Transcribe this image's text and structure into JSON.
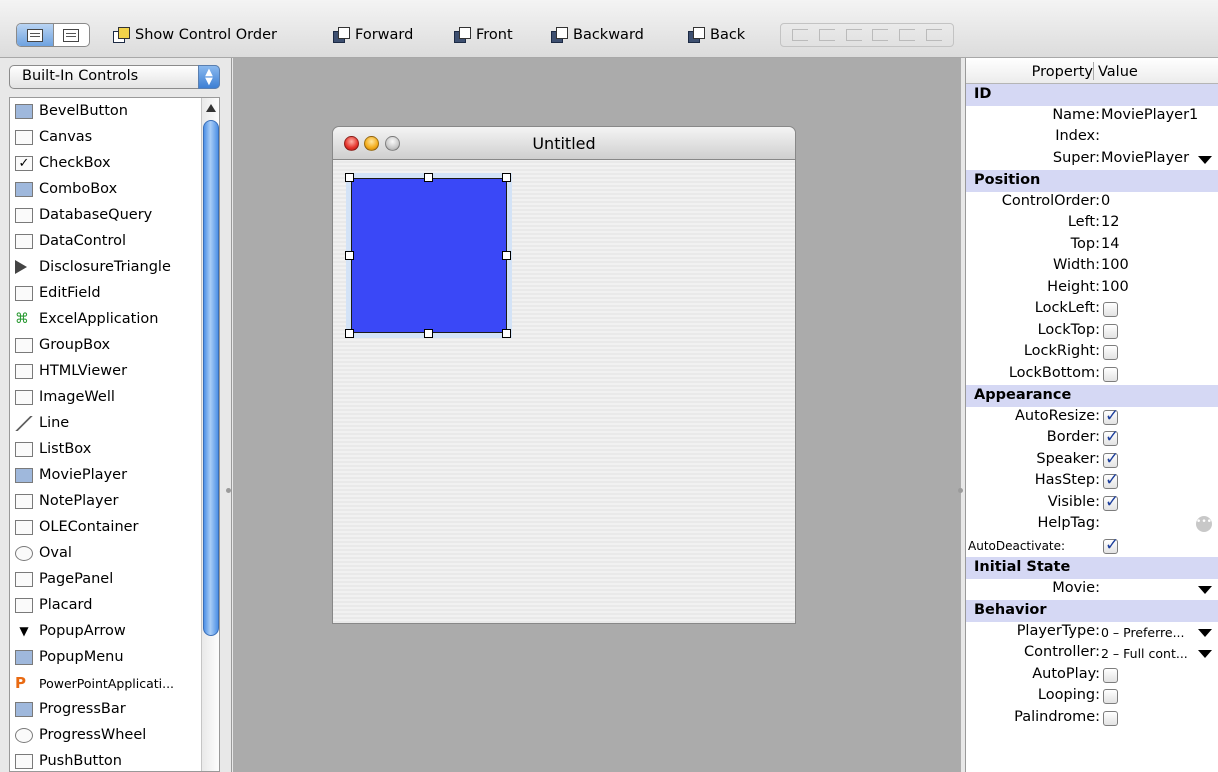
{
  "toolbar": {
    "show_control_order": "Show Control Order",
    "forward": "Forward",
    "front": "Front",
    "backward": "Backward",
    "back": "Back"
  },
  "palette": {
    "selected": "Built-In Controls",
    "items": [
      {
        "label": "BevelButton",
        "icon": "bevel-button-icon"
      },
      {
        "label": "Canvas",
        "icon": "canvas-icon"
      },
      {
        "label": "CheckBox",
        "icon": "checkbox-icon"
      },
      {
        "label": "ComboBox",
        "icon": "combobox-icon"
      },
      {
        "label": "DatabaseQuery",
        "icon": "database-query-icon"
      },
      {
        "label": "DataControl",
        "icon": "data-control-icon"
      },
      {
        "label": "DisclosureTriangle",
        "icon": "disclosure-triangle-icon"
      },
      {
        "label": "EditField",
        "icon": "edit-field-icon"
      },
      {
        "label": "ExcelApplication",
        "icon": "excel-application-icon"
      },
      {
        "label": "GroupBox",
        "icon": "group-box-icon"
      },
      {
        "label": "HTMLViewer",
        "icon": "html-viewer-icon"
      },
      {
        "label": "ImageWell",
        "icon": "image-well-icon"
      },
      {
        "label": "Line",
        "icon": "line-icon"
      },
      {
        "label": "ListBox",
        "icon": "list-box-icon"
      },
      {
        "label": "MoviePlayer",
        "icon": "movie-player-icon"
      },
      {
        "label": "NotePlayer",
        "icon": "note-player-icon"
      },
      {
        "label": "OLEContainer",
        "icon": "ole-container-icon"
      },
      {
        "label": "Oval",
        "icon": "oval-icon"
      },
      {
        "label": "PagePanel",
        "icon": "page-panel-icon"
      },
      {
        "label": "Placard",
        "icon": "placard-icon"
      },
      {
        "label": "PopupArrow",
        "icon": "popup-arrow-icon"
      },
      {
        "label": "PopupMenu",
        "icon": "popup-menu-icon"
      },
      {
        "label": "PowerPointApplicati...",
        "icon": "powerpoint-application-icon"
      },
      {
        "label": "ProgressBar",
        "icon": "progress-bar-icon"
      },
      {
        "label": "ProgressWheel",
        "icon": "progress-wheel-icon"
      },
      {
        "label": "PushButton",
        "icon": "push-button-icon"
      }
    ]
  },
  "window": {
    "title": "Untitled"
  },
  "properties": {
    "header_property": "Property",
    "header_value": "Value",
    "sections": {
      "id": "ID",
      "position": "Position",
      "appearance": "Appearance",
      "initial_state": "Initial State",
      "behavior": "Behavior"
    },
    "name_label": "Name:",
    "name_value": "MoviePlayer1",
    "index_label": "Index:",
    "super_label": "Super:",
    "super_value": "MoviePlayer",
    "controlorder_label": "ControlOrder:",
    "controlorder_value": "0",
    "left_label": "Left:",
    "left_value": "12",
    "top_label": "Top:",
    "top_value": "14",
    "width_label": "Width:",
    "width_value": "100",
    "height_label": "Height:",
    "height_value": "100",
    "lockleft_label": "LockLeft:",
    "lockleft_value": false,
    "locktop_label": "LockTop:",
    "locktop_value": false,
    "lockright_label": "LockRight:",
    "lockright_value": false,
    "lockbottom_label": "LockBottom:",
    "lockbottom_value": false,
    "autoresize_label": "AutoResize:",
    "autoresize_value": true,
    "border_label": "Border:",
    "border_value": true,
    "speaker_label": "Speaker:",
    "speaker_value": true,
    "hasstep_label": "HasStep:",
    "hasstep_value": true,
    "visible_label": "Visible:",
    "visible_value": true,
    "helptag_label": "HelpTag:",
    "autodeactivate_label": "AutoDeactivate:",
    "autodeactivate_value": true,
    "movie_label": "Movie:",
    "playertype_label": "PlayerType:",
    "playertype_value": "0 – Preferre...",
    "controller_label": "Controller:",
    "controller_value": "2 – Full cont...",
    "autoplay_label": "AutoPlay:",
    "autoplay_value": false,
    "looping_label": "Looping:",
    "looping_value": false,
    "palindrome_label": "Palindrome:",
    "palindrome_value": false
  },
  "colors": {
    "movie_fill": "#3a48f7",
    "section_header": "#d5d8f4",
    "scroll_thumb": "#4d90e6"
  }
}
